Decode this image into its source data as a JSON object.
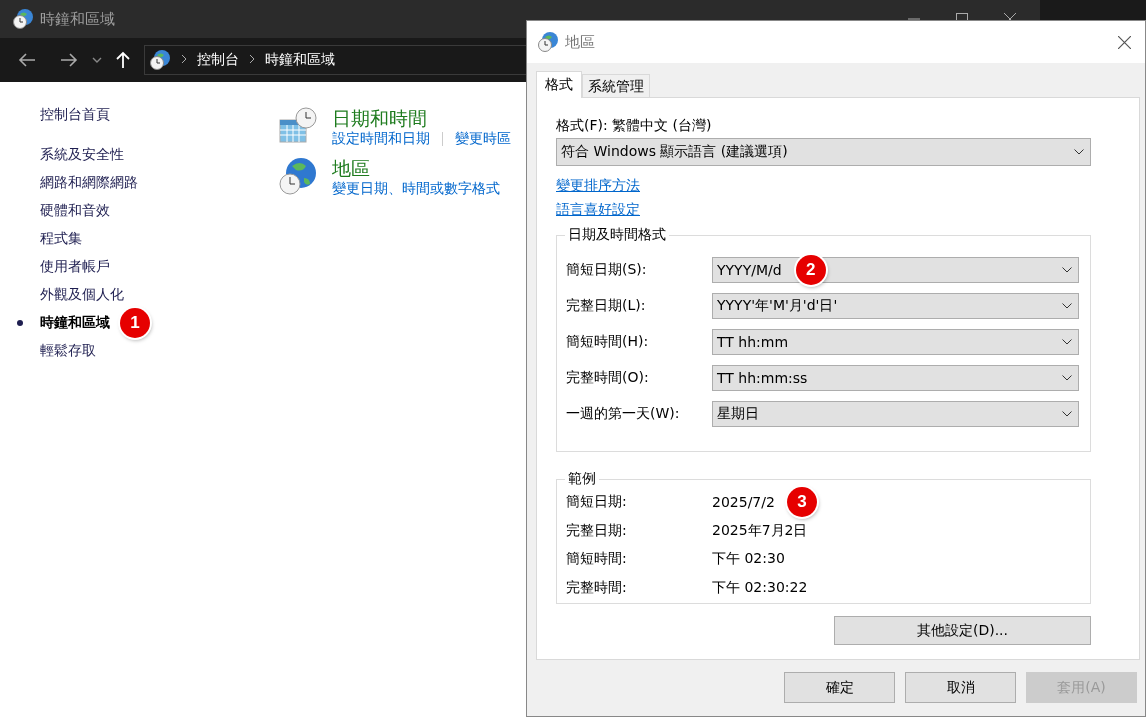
{
  "window": {
    "title": "時鐘和區域"
  },
  "address_bar": {
    "path": [
      "控制台",
      "時鐘和區域"
    ]
  },
  "sidebar": {
    "home": "控制台首頁",
    "items": [
      {
        "label": "系統及安全性",
        "selected": false
      },
      {
        "label": "網路和網際網路",
        "selected": false
      },
      {
        "label": "硬體和音效",
        "selected": false
      },
      {
        "label": "程式集",
        "selected": false
      },
      {
        "label": "使用者帳戶",
        "selected": false
      },
      {
        "label": "外觀及個人化",
        "selected": false
      },
      {
        "label": "時鐘和區域",
        "selected": true,
        "marker": "1"
      },
      {
        "label": "輕鬆存取",
        "selected": false
      }
    ]
  },
  "categories": [
    {
      "kind": "calendar",
      "title": "日期和時間",
      "links": [
        "設定時間和日期",
        "變更時區"
      ]
    },
    {
      "kind": "globe",
      "title": "地區",
      "links": [
        "變更日期、時間或數字格式"
      ]
    }
  ],
  "dialog": {
    "title": "地區",
    "tabs": [
      {
        "label": "格式",
        "selected": true
      },
      {
        "label": "系統管理",
        "selected": false
      }
    ],
    "format_label": "格式(F): 繁體中文 (台灣)",
    "format_value": "符合 Windows 顯示語言 (建議選項)",
    "links": [
      "變更排序方法",
      "語言喜好設定"
    ],
    "formats": {
      "title": "日期及時間格式",
      "rows": [
        {
          "label": "簡短日期(S):",
          "value": "YYYY/M/d",
          "marker": "2"
        },
        {
          "label": "完整日期(L):",
          "value": "YYYY'年'M'月'd'日'"
        },
        {
          "label": "簡短時間(H):",
          "value": "TT hh:mm"
        },
        {
          "label": "完整時間(O):",
          "value": "TT hh:mm:ss"
        },
        {
          "label": "一週的第一天(W):",
          "value": "星期日"
        }
      ]
    },
    "examples": {
      "title": "範例",
      "rows": [
        {
          "label": "簡短日期:",
          "value": "2025/7/2",
          "marker": "3"
        },
        {
          "label": "完整日期:",
          "value": "2025年7月2日"
        },
        {
          "label": "簡短時間:",
          "value": "下午 02:30"
        },
        {
          "label": "完整時間:",
          "value": "下午 02:30:22"
        }
      ]
    },
    "more_button": "其他設定(D)...",
    "buttons": [
      {
        "label": "確定",
        "disabled": false
      },
      {
        "label": "取消",
        "disabled": false
      },
      {
        "label": "套用(A)",
        "disabled": true
      }
    ]
  }
}
